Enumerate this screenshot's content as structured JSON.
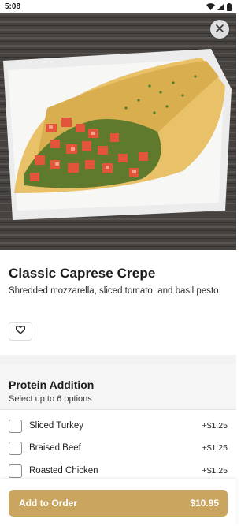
{
  "status_bar": {
    "time": "5:08",
    "icons": [
      "wifi-icon",
      "signal-icon",
      "battery-icon"
    ]
  },
  "hero": {
    "image": "caprese-crepe-photo",
    "close_icon": "close-icon"
  },
  "item": {
    "title": "Classic Caprese Crepe",
    "description": "Shredded mozzarella, sliced tomato, and basil pesto.",
    "favorite_icon": "heart-icon"
  },
  "section": {
    "title": "Protein Addition",
    "subtitle": "Select up to 6 options",
    "options": [
      {
        "label": "Sliced Turkey",
        "price": "+$1.25",
        "checked": false
      },
      {
        "label": "Braised Beef",
        "price": "+$1.25",
        "checked": false
      },
      {
        "label": "Roasted Chicken",
        "price": "+$1.25",
        "checked": false
      }
    ]
  },
  "cart": {
    "button_label": "Add to Order",
    "total": "$10.95"
  },
  "colors": {
    "accent": "#c9a55f",
    "section_bg": "#f5f5f5",
    "text": "#1b1b1b"
  }
}
